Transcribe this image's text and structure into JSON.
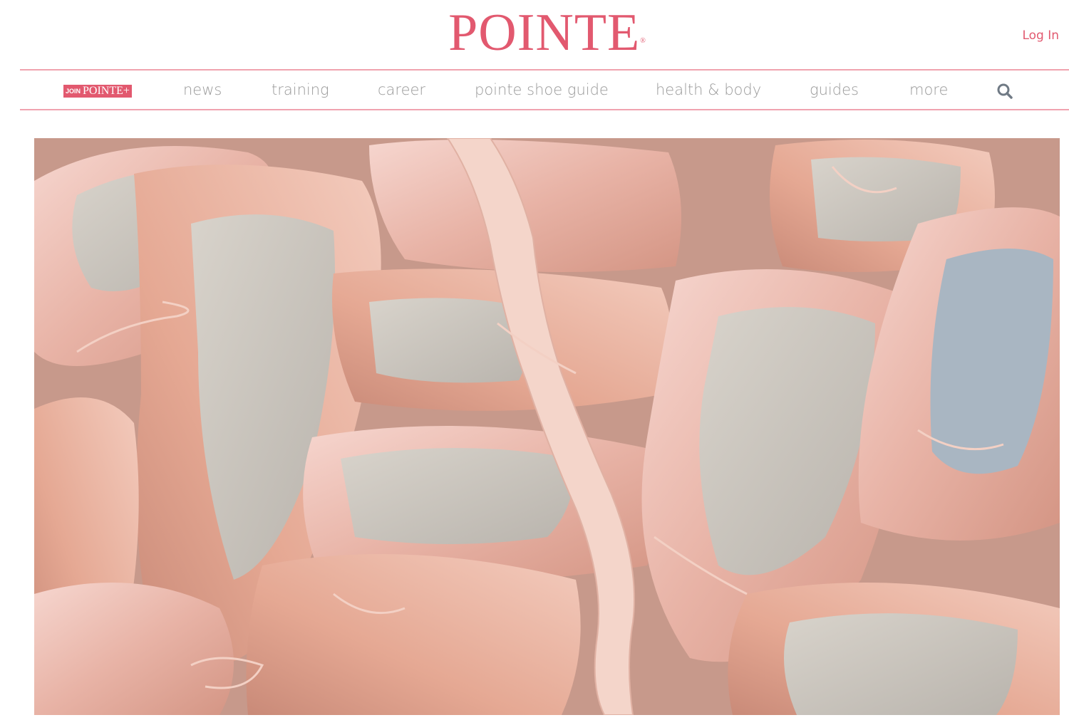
{
  "header": {
    "logo_text": "POINTE",
    "logo_mark": "®",
    "login_label": "Log In",
    "brand_color": "#e2596f"
  },
  "nav": {
    "join_small": "JOIN",
    "join_big": "POINTE+",
    "items": [
      {
        "label": "news"
      },
      {
        "label": "training"
      },
      {
        "label": "career"
      },
      {
        "label": "pointe shoe guide"
      },
      {
        "label": "health & body"
      },
      {
        "label": "guides"
      },
      {
        "label": "more"
      }
    ],
    "search_icon": "search-icon"
  },
  "hero": {
    "image_subject": "pile of pink satin pointe shoes with ribbons"
  }
}
